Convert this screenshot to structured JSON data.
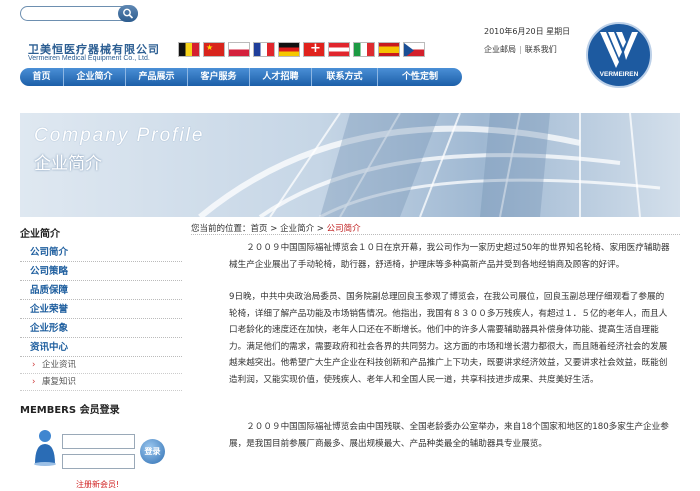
{
  "header": {
    "logo_cn": "卫美恒医疗器械有限公司",
    "logo_en": "Vermeiren Medical Equipment Co., Ltd.",
    "date": "2010年6月20日 星期日",
    "link_email": "企业邮局",
    "link_contact": "联系我们",
    "separator": "|",
    "brand_logo_text": "VERMEIREN",
    "flags": [
      "belgium",
      "china",
      "poland",
      "france",
      "germany",
      "switzerland",
      "austria",
      "italy",
      "spain",
      "czech"
    ]
  },
  "nav": {
    "items": [
      "首页",
      "企业简介",
      "产品展示",
      "客户服务",
      "人才招聘",
      "联系方式",
      "个性定制"
    ]
  },
  "banner": {
    "title_en": "Company Profile",
    "title_cn": "企业简介"
  },
  "sidebar": {
    "title": "企业简介",
    "items": [
      "公司简介",
      "公司策略",
      "品质保障",
      "企业荣誉",
      "企业形象",
      "资讯中心"
    ],
    "sub_items": [
      "企业资讯",
      "康复知识"
    ],
    "members_title": "MEMBERS 会员登录",
    "login_button": "登录",
    "register": "注册新会员!"
  },
  "breadcrumb": {
    "prefix": "您当前的位置：",
    "home": "首页",
    "sep": " > ",
    "section": "企业简介",
    "current": "公司简介"
  },
  "content": {
    "paragraphs": [
      "２００９中国国际福祉博览会１０日在京开幕，我公司作为一家历史超过50年的世界知名轮椅、家用医疗辅助器械生产企业展出了手动轮椅，助行器，舒适椅，护理床等多种高新产品并受到各地经销商及顾客的好评。",
      "9日晚，中共中央政治局委员、国务院副总理回良玉参观了博览会，在我公司展位，回良玉副总理仔细观看了参展的轮椅，详细了解产品功能及市场销售情况。他指出，我国有８３００多万残疾人，有超过１．５亿的老年人，而且人口老龄化的速度还在加快，老年人口还在不断增长。他们中的许多人需要辅助器具补偿身体功能、提高生活自理能力。满足他们的需求，需要政府和社会各界的共同努力。这方面的市场和增长潜力都很大，而且随着经济社会的发展越来越突出。他希望广大生产企业在科技创新和产品推广上下功夫，既要讲求经济效益，又要讲求社会效益，既能创造利润，又能实现价值，使残疾人、老年人和全国人民一道，共享科技进步成果、共度美好生活。",
      "２００９中国国际福祉博览会由中国残联、全国老龄委办公室举办，来自18个国家和地区的180多家生产企业参展，是我国目前参展厂商最多、展出规模最大、产品种类最全的辅助器具专业展览。"
    ]
  }
}
